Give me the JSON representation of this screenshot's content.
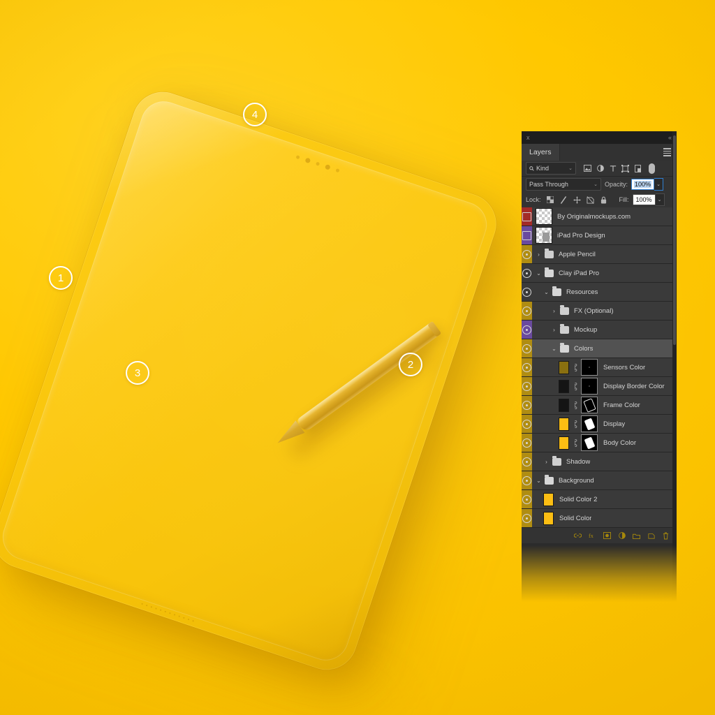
{
  "scene": {
    "background_color": "#FFC800",
    "device_label": "Clay iPad Pro mockup",
    "pencil_label": "Apple Pencil",
    "callouts": [
      {
        "number": "1",
        "name": "callout-1-frame-edge"
      },
      {
        "number": "2",
        "name": "callout-2-apple-pencil"
      },
      {
        "number": "3",
        "name": "callout-3-display"
      },
      {
        "number": "4",
        "name": "callout-4-sensors"
      }
    ]
  },
  "panel": {
    "close_label": "x",
    "collapse_label": "«",
    "tab_label": "Layers",
    "menu_label": "Panel menu",
    "filter": {
      "kind_label": "Kind",
      "search_icon": "magnifier-icon",
      "chevron": "⌄",
      "icons": [
        "pixel-layer-filter-icon",
        "adjustment-layer-filter-icon",
        "type-layer-filter-icon",
        "shape-layer-filter-icon",
        "smart-object-filter-icon"
      ],
      "toggle_name": "filter-enable-toggle"
    },
    "blend": {
      "mode": "Pass Through",
      "chevron": "⌄",
      "opacity_label": "Opacity:",
      "opacity_value": "100%"
    },
    "lock": {
      "label": "Lock:",
      "icons": [
        "lock-transparent-pixels-icon",
        "lock-image-pixels-icon",
        "lock-position-icon",
        "lock-artboard-nesting-icon",
        "lock-all-icon"
      ],
      "fill_label": "Fill:",
      "fill_value": "100%"
    },
    "layers": [
      {
        "name": "By Originalmockups.com",
        "tag": "#a32b28",
        "visible": false,
        "eye_style": "box",
        "indent": 0,
        "kind": "thumb",
        "twisty": "",
        "selected": false
      },
      {
        "name": "iPad Pro Design",
        "tag": "#6a4a9e",
        "visible": false,
        "eye_style": "box",
        "indent": 0,
        "kind": "thumb-smart",
        "twisty": "",
        "selected": false
      },
      {
        "name": "Apple Pencil",
        "tag": "#b08d12",
        "visible": true,
        "eye_style": "eye",
        "indent": 0,
        "kind": "folder",
        "twisty": "›",
        "selected": false
      },
      {
        "name": "Clay iPad Pro",
        "tag": "",
        "visible": true,
        "eye_style": "eye",
        "indent": 0,
        "kind": "folder-open",
        "twisty": "⌄",
        "selected": false
      },
      {
        "name": "Resources",
        "tag": "",
        "visible": true,
        "eye_style": "eye",
        "indent": 1,
        "kind": "folder-open",
        "twisty": "⌄",
        "selected": false
      },
      {
        "name": "FX (Optional)",
        "tag": "#b08d12",
        "visible": true,
        "eye_style": "eye",
        "indent": 2,
        "kind": "folder",
        "twisty": "›",
        "selected": false
      },
      {
        "name": "Mockup",
        "tag": "#6a4a9e",
        "visible": true,
        "eye_style": "eye",
        "indent": 2,
        "kind": "folder",
        "twisty": "›",
        "selected": false
      },
      {
        "name": "Colors",
        "tag": "#b08d12",
        "visible": true,
        "eye_style": "eye",
        "indent": 2,
        "kind": "folder-open",
        "twisty": "⌄",
        "selected": true
      },
      {
        "name": "Sensors Color",
        "tag": "#b08d12",
        "visible": true,
        "eye_style": "eye",
        "indent": 3,
        "kind": "solid",
        "swatch": "#8a7010",
        "mask": "dots",
        "twisty": "",
        "selected": false
      },
      {
        "name": "Display Border Color",
        "tag": "#b08d12",
        "visible": true,
        "eye_style": "eye",
        "indent": 3,
        "kind": "solid",
        "swatch": "#141414",
        "mask": "dots",
        "twisty": "",
        "selected": false
      },
      {
        "name": "Frame Color",
        "tag": "#b08d12",
        "visible": true,
        "eye_style": "eye",
        "indent": 3,
        "kind": "solid",
        "swatch": "#141414",
        "mask": "outline",
        "twisty": "",
        "selected": false
      },
      {
        "name": "Display",
        "tag": "#b08d12",
        "visible": true,
        "eye_style": "eye",
        "indent": 3,
        "kind": "solid",
        "swatch": "#fcbe13",
        "mask": "solid",
        "twisty": "",
        "selected": false
      },
      {
        "name": "Body Color",
        "tag": "#b08d12",
        "visible": true,
        "eye_style": "eye",
        "indent": 3,
        "kind": "solid",
        "swatch": "#fcbe13",
        "mask": "solid",
        "twisty": "",
        "selected": false
      },
      {
        "name": "Shadow",
        "tag": "#b08d12",
        "visible": true,
        "eye_style": "eye",
        "indent": 1,
        "kind": "folder",
        "twisty": "›",
        "selected": false
      },
      {
        "name": "Background",
        "tag": "#b08d12",
        "visible": true,
        "eye_style": "eye",
        "indent": 0,
        "kind": "folder-open",
        "twisty": "⌄",
        "selected": false
      },
      {
        "name": "Solid Color 2",
        "tag": "#b08d12",
        "visible": true,
        "eye_style": "eye",
        "indent": 1,
        "kind": "solid-simple",
        "swatch": "#fcbe13",
        "twisty": "",
        "selected": false
      },
      {
        "name": "Solid Color",
        "tag": "#b08d12",
        "visible": true,
        "eye_style": "eye",
        "indent": 1,
        "kind": "solid-simple",
        "swatch": "#fcbe13",
        "twisty": "",
        "selected": false
      }
    ],
    "bottom_icons": [
      "link-layers-icon",
      "layer-style-fx-icon",
      "add-layer-mask-icon",
      "new-adjustment-layer-icon",
      "new-group-icon",
      "new-layer-icon",
      "delete-layer-icon"
    ]
  }
}
